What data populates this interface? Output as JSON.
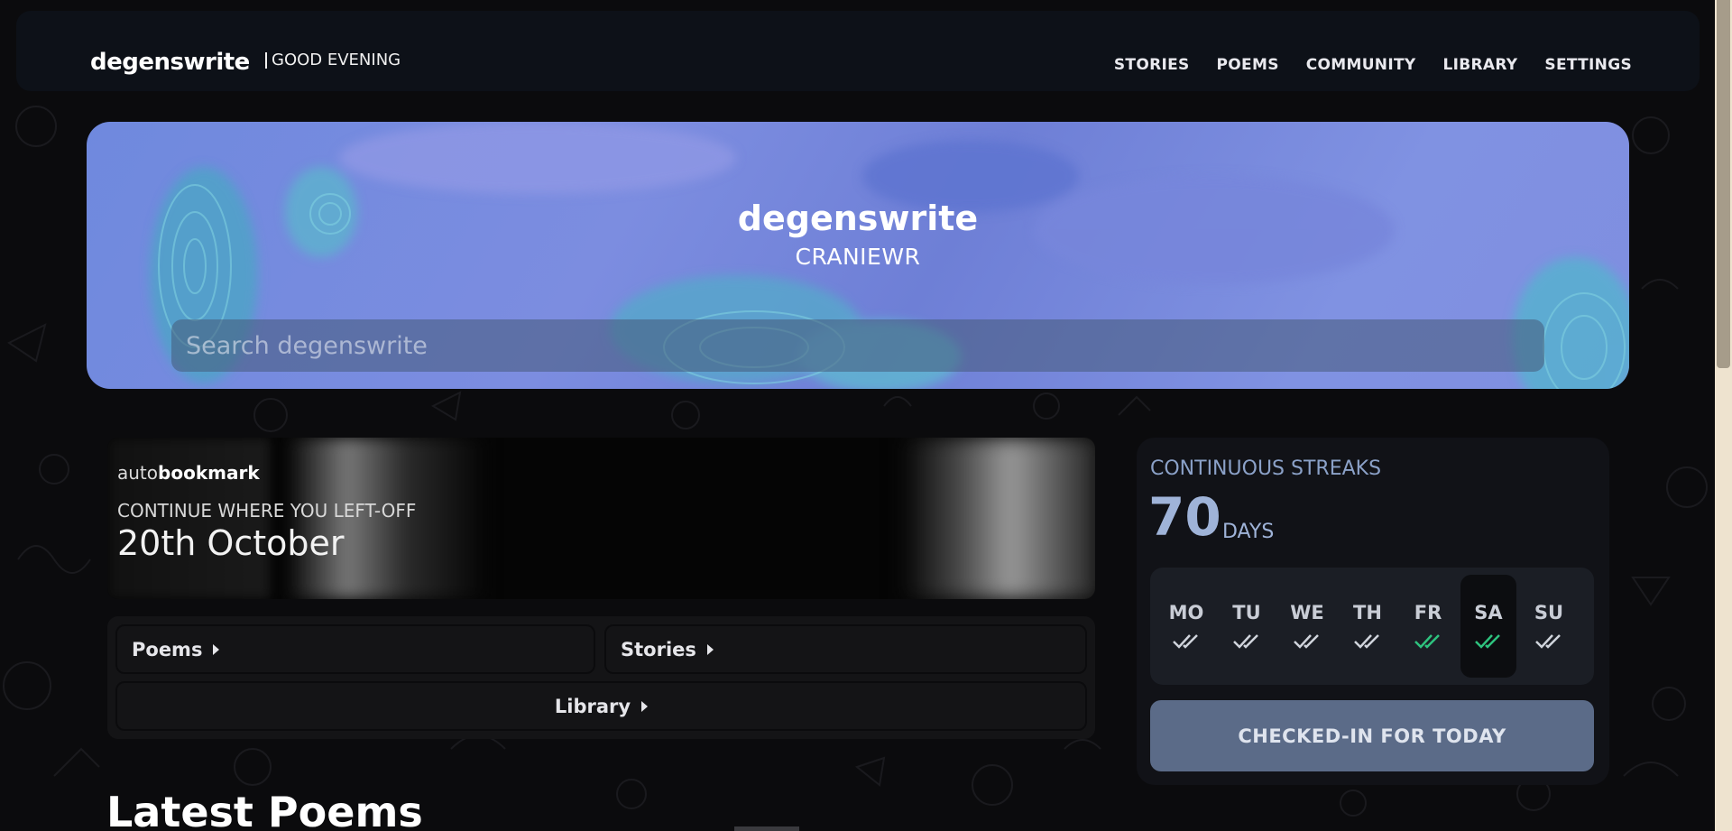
{
  "navbar": {
    "brand": "degenswrite",
    "greeting": "GOOD EVENING",
    "links": [
      "STORIES",
      "POEMS",
      "COMMUNITY",
      "LIBRARY",
      "SETTINGS"
    ]
  },
  "hero": {
    "title": "degenswrite",
    "username": "CRANIEWR",
    "search_placeholder": "Search degenswrite"
  },
  "bookmark": {
    "label_prefix": "auto",
    "label_bold": "bookmark",
    "caption": "CONTINUE WHERE YOU LEFT-OFF",
    "date": "20th October"
  },
  "quicklinks": {
    "poems": "Poems",
    "stories": "Stories",
    "library": "Library"
  },
  "latest": {
    "heading": "Latest Poems"
  },
  "streak": {
    "title": "CONTINUOUS STREAKS",
    "count": "70",
    "unit": "DAYS",
    "days": [
      {
        "label": "MO",
        "done": true,
        "highlight": false
      },
      {
        "label": "TU",
        "done": true,
        "highlight": false
      },
      {
        "label": "WE",
        "done": true,
        "highlight": false
      },
      {
        "label": "TH",
        "done": true,
        "highlight": false
      },
      {
        "label": "FR",
        "done": true,
        "highlight": true
      },
      {
        "label": "SA",
        "done": true,
        "highlight": true,
        "today": true
      },
      {
        "label": "SU",
        "done": true,
        "highlight": false
      }
    ],
    "checkin_label": "CHECKED-IN FOR TODAY",
    "colors": {
      "check_default": "#d0d4dc",
      "check_highlight": "#2ec27e"
    }
  }
}
